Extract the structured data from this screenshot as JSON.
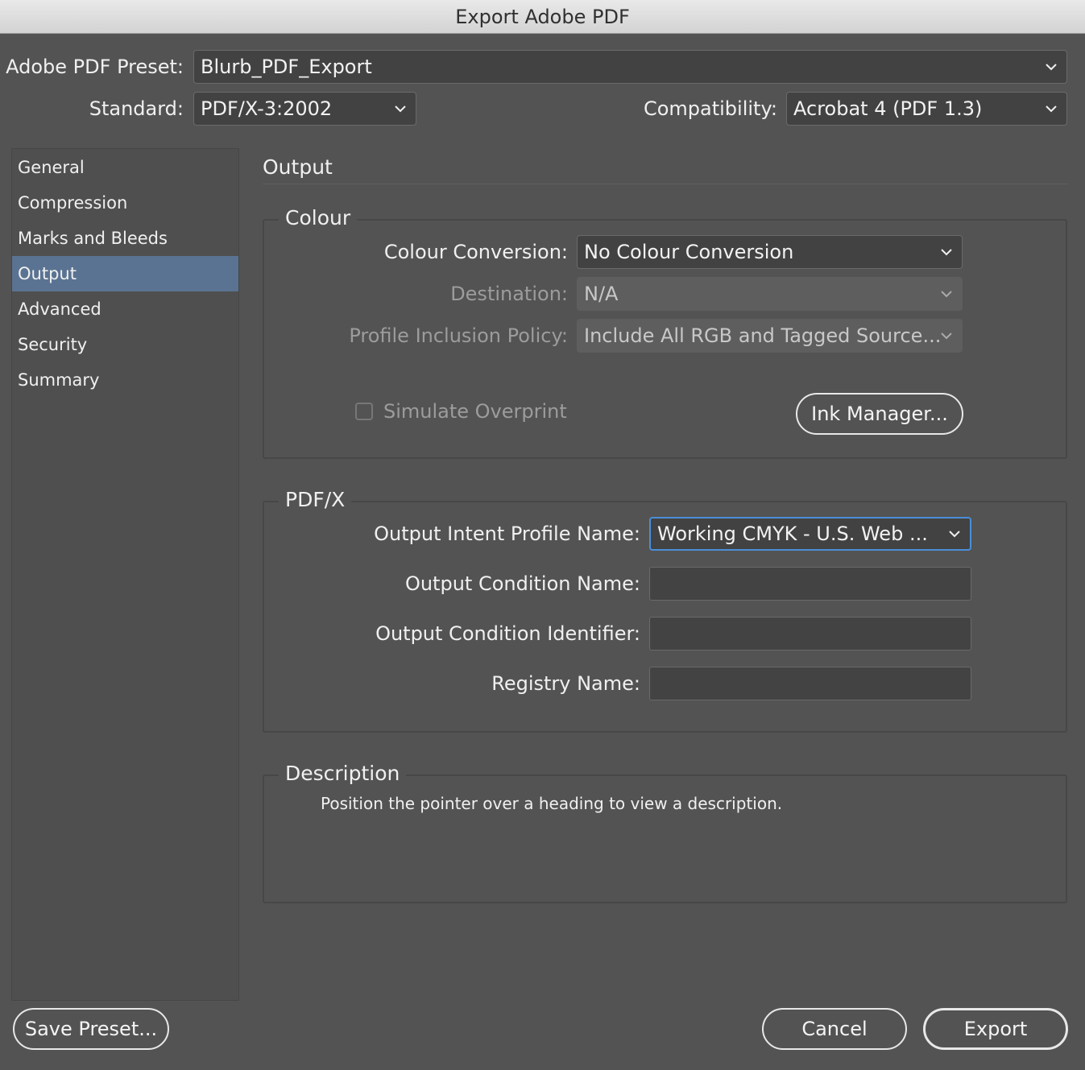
{
  "window": {
    "title": "Export Adobe PDF"
  },
  "header": {
    "preset_label": "Adobe PDF Preset:",
    "preset_value": "Blurb_PDF_Export",
    "standard_label": "Standard:",
    "standard_value": "PDF/X-3:2002",
    "compat_label": "Compatibility:",
    "compat_value": "Acrobat 4 (PDF 1.3)"
  },
  "sidebar": {
    "active": "Output",
    "items": [
      {
        "label": "General"
      },
      {
        "label": "Compression"
      },
      {
        "label": "Marks and Bleeds"
      },
      {
        "label": "Output"
      },
      {
        "label": "Advanced"
      },
      {
        "label": "Security"
      },
      {
        "label": "Summary"
      }
    ]
  },
  "main": {
    "section_title": "Output",
    "colour": {
      "legend": "Colour",
      "conversion_label": "Colour Conversion:",
      "conversion_value": "No Colour Conversion",
      "destination_label": "Destination:",
      "destination_value": "N/A",
      "profile_label": "Profile Inclusion Policy:",
      "profile_value": "Include All RGB and Tagged Source...",
      "simulate_label": "Simulate Overprint",
      "simulate_checked": false,
      "ink_button": "Ink Manager..."
    },
    "pdfx": {
      "legend": "PDF/X",
      "intent_label": "Output Intent Profile Name:",
      "intent_value": "Working CMYK - U.S. Web ...",
      "condition_name_label": "Output Condition Name:",
      "condition_name_value": "",
      "condition_id_label": "Output Condition Identifier:",
      "condition_id_value": "",
      "registry_label": "Registry Name:",
      "registry_value": ""
    },
    "description": {
      "legend": "Description",
      "text": "Position the pointer over a heading to view a description."
    }
  },
  "footer": {
    "save_preset": "Save Preset...",
    "cancel": "Cancel",
    "export": "Export"
  },
  "colors": {
    "dialog_bg": "#535353",
    "selection": "#5a7392",
    "focus_ring": "#4a8ed8"
  },
  "icons": {
    "dropdown": "chevron-down-icon"
  }
}
